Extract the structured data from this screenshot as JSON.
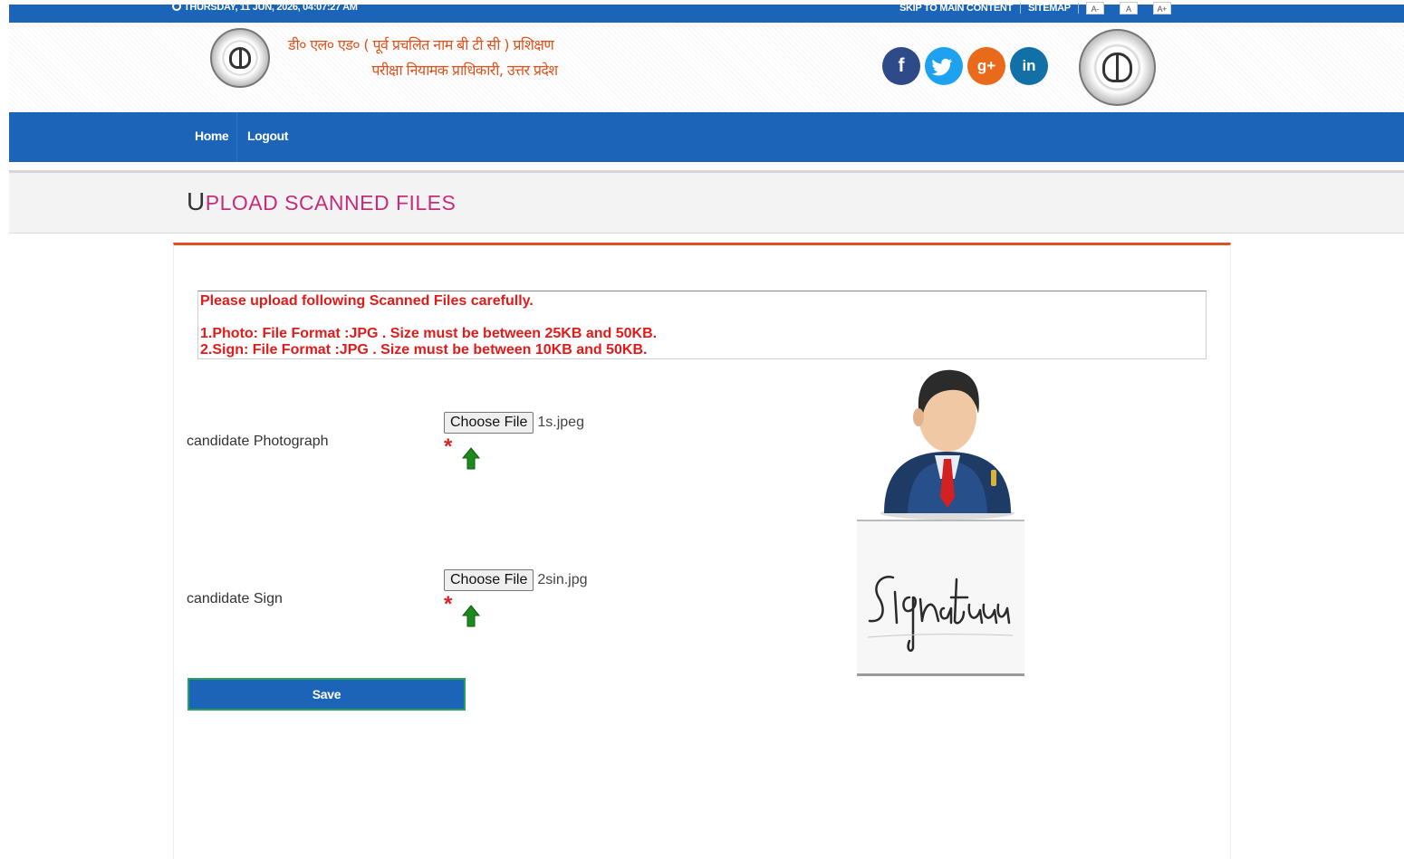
{
  "topbar": {
    "datetime": "THURSDAY, 11 JUN, 2026, 04:07:27 AM",
    "skip_link": "SKIP TO MAIN CONTENT",
    "sitemap": "SITEMAP",
    "font_smaller": "A-",
    "font_normal": "A",
    "font_larger": "A+"
  },
  "header": {
    "title_line1": "डी० एल० एड० ( पूर्व प्रचलित नाम बी टी सी ) प्रशिक्षण",
    "title_line2": "परीक्षा नियामक प्राधिकारी, उत्तर प्रदेश",
    "social": {
      "facebook": "f",
      "twitter": "t",
      "googleplus": "g+",
      "linkedin": "in"
    }
  },
  "nav": {
    "home": "Home",
    "logout": "Logout"
  },
  "page": {
    "title_cap": "U",
    "title_rest": "PLOAD SCANNED FILES"
  },
  "instructions": {
    "heading": "Please upload following Scanned Files carefully.",
    "line1": "1.Photo: File Format :JPG . Size must be between 25KB and 50KB.",
    "line2": "2.Sign: File Format :JPG . Size must be between 10KB and 50KB."
  },
  "photo_field": {
    "label": "candidate Photograph",
    "button": "Choose File",
    "file_name": "1s.jpeg",
    "required_mark": "*"
  },
  "sign_field": {
    "label": "candidate Sign",
    "button": "Choose File",
    "file_name": "2sin.jpg",
    "required_mark": "*"
  },
  "actions": {
    "save": "Save"
  },
  "colors": {
    "primary_blue": "#1c64b8",
    "accent_orange": "#e0521b",
    "title_pink": "#c72c7a",
    "error_red": "#e31a1a"
  }
}
